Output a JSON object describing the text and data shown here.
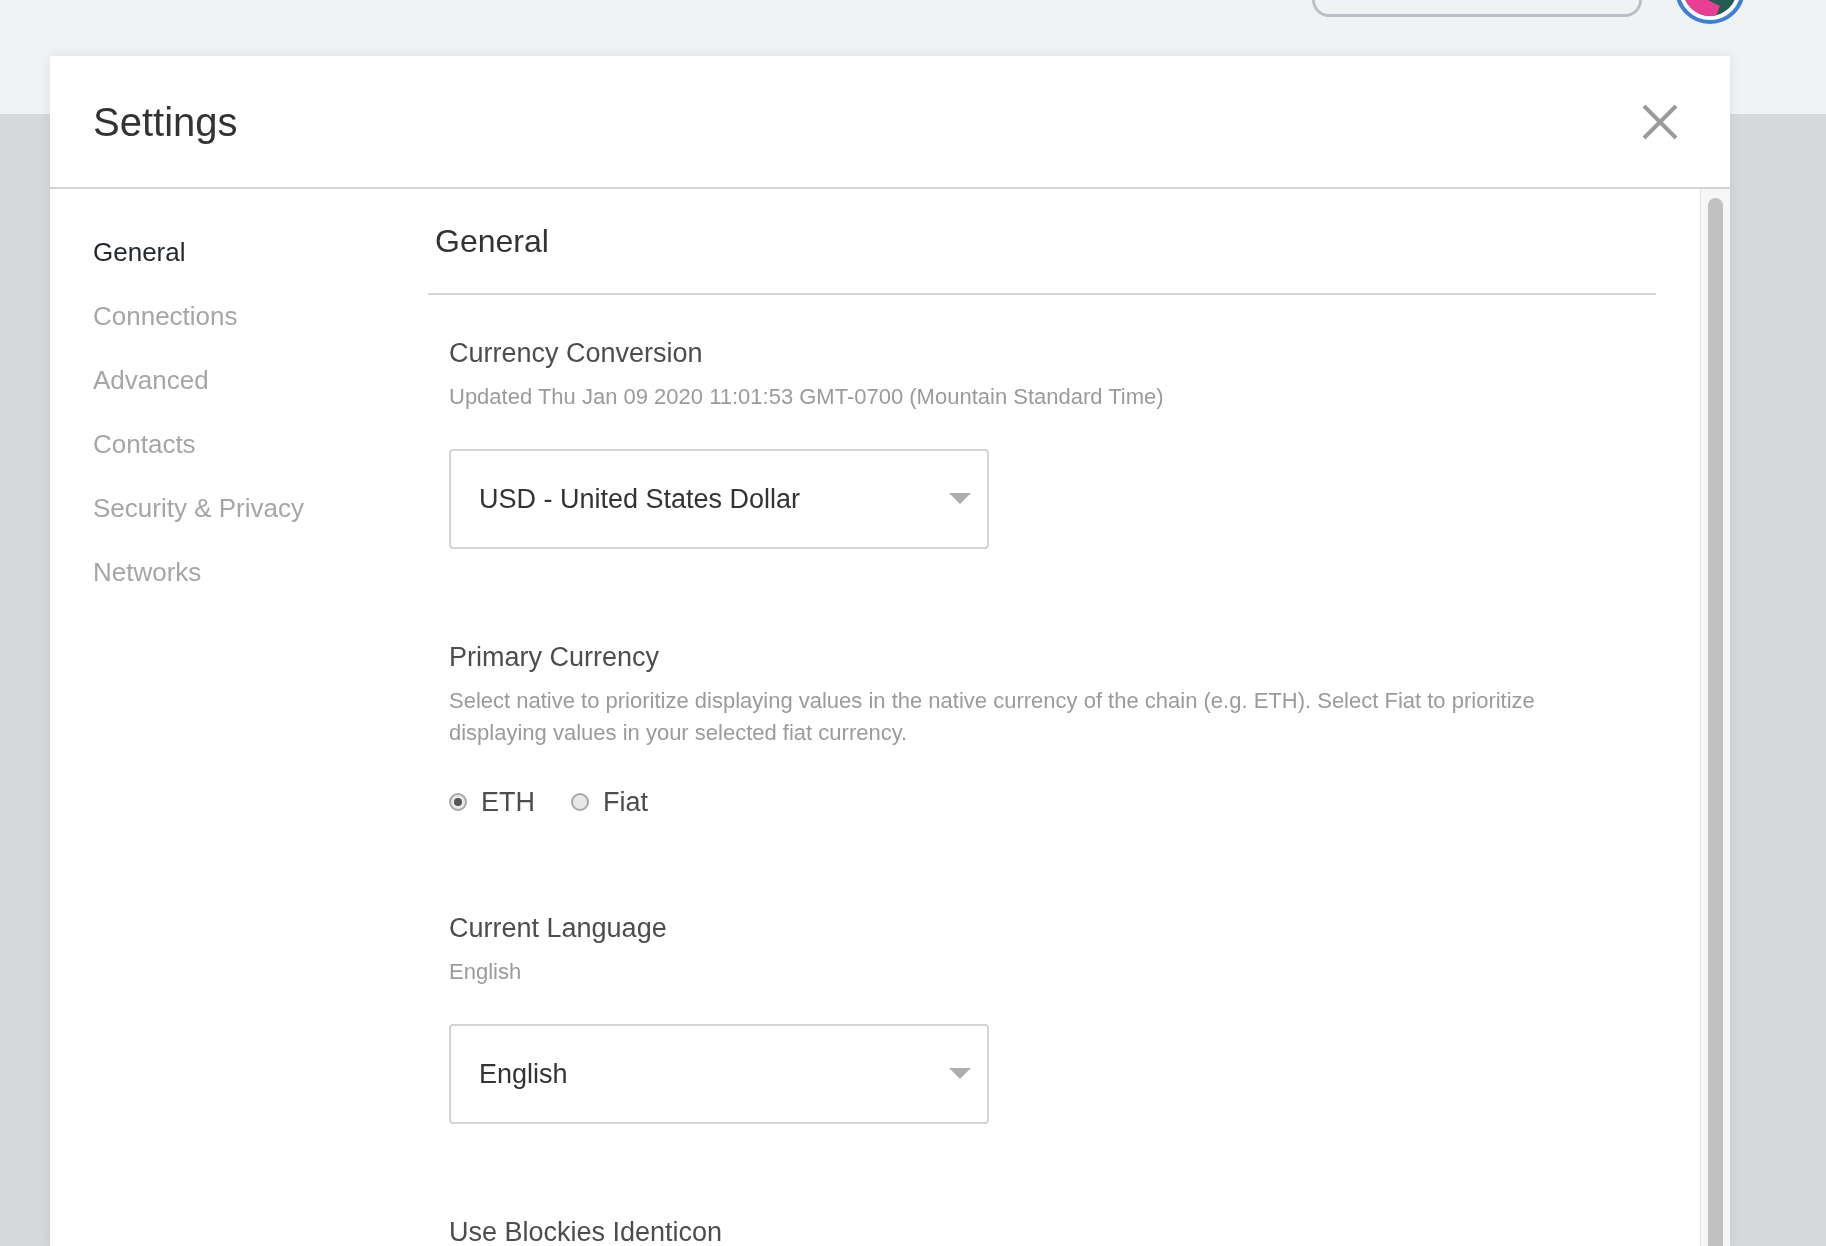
{
  "window": {
    "title": "Settings"
  },
  "sidebar": {
    "items": [
      {
        "label": "General",
        "selected": true
      },
      {
        "label": "Connections",
        "selected": false
      },
      {
        "label": "Advanced",
        "selected": false
      },
      {
        "label": "Contacts",
        "selected": false
      },
      {
        "label": "Security & Privacy",
        "selected": false
      },
      {
        "label": "Networks",
        "selected": false
      }
    ]
  },
  "content": {
    "title": "General",
    "sections": [
      {
        "kind": "select",
        "title": "Currency Conversion",
        "description": "Updated Thu Jan 09 2020 11:01:53 GMT-0700 (Mountain Standard Time)",
        "value": "USD - United States Dollar"
      },
      {
        "kind": "radio",
        "title": "Primary Currency",
        "description": "Select native to prioritize displaying values in the native currency of the chain (e.g. ETH). Select Fiat to prioritize displaying values in your selected fiat currency.",
        "options": [
          {
            "label": "ETH",
            "selected": true
          },
          {
            "label": "Fiat",
            "selected": false
          }
        ]
      },
      {
        "kind": "select",
        "title": "Current Language",
        "description": "English",
        "value": "English"
      },
      {
        "kind": "heading",
        "title": "Use Blockies Identicon"
      }
    ]
  }
}
